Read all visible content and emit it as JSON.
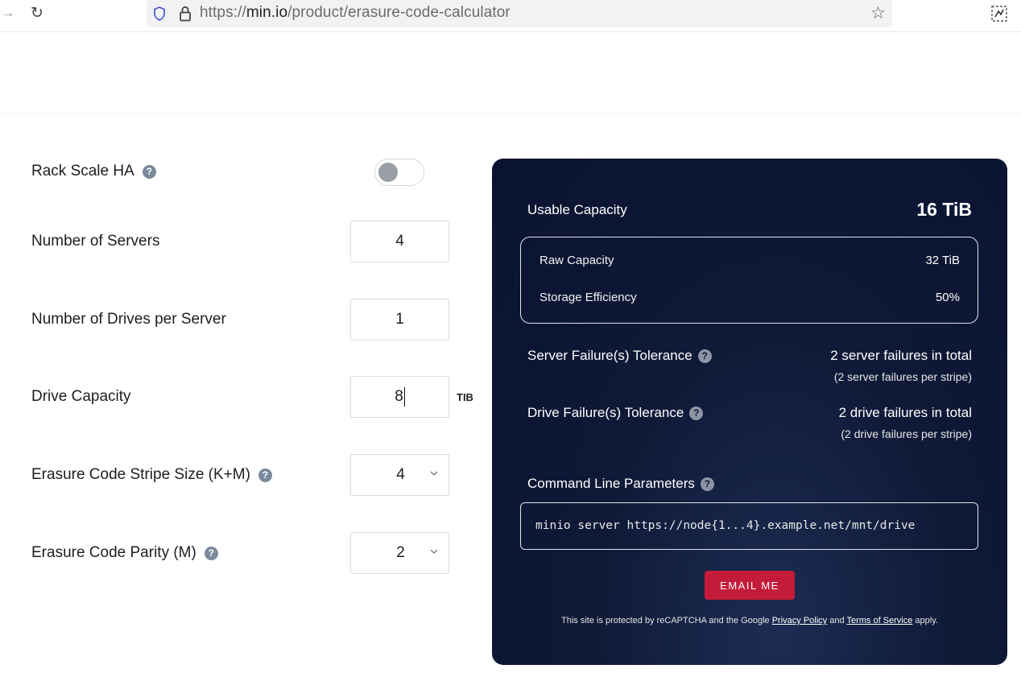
{
  "browser": {
    "url_prefix": "https://",
    "url_host": "min.io",
    "url_path": "/product/erasure-code-calculator"
  },
  "form": {
    "rack_scale_label": "Rack Scale HA",
    "rack_scale_enabled": false,
    "servers_label": "Number of Servers",
    "servers_value": "4",
    "drives_label": "Number of Drives per Server",
    "drives_value": "1",
    "capacity_label": "Drive Capacity",
    "capacity_value": "8",
    "capacity_unit": "TIB",
    "stripe_label": "Erasure Code Stripe Size (K+M)",
    "stripe_value": "4",
    "parity_label": "Erasure Code Parity (M)",
    "parity_value": "2",
    "help_glyph": "?"
  },
  "results": {
    "usable_label": "Usable Capacity",
    "usable_value": "16 TiB",
    "raw_label": "Raw Capacity",
    "raw_value": "32 TiB",
    "efficiency_label": "Storage Efficiency",
    "efficiency_value": "50%",
    "server_tol_label": "Server Failure(s) Tolerance",
    "server_tol_value": "2 server failures in total",
    "server_tol_sub": "(2 server failures per stripe)",
    "drive_tol_label": "Drive Failure(s) Tolerance",
    "drive_tol_value": "2 drive failures in total",
    "drive_tol_sub": "(2 drive failures per stripe)",
    "cmd_label": "Command Line Parameters",
    "cmd_value": "minio server https://node{1...4}.example.net/mnt/drive",
    "email_label": "EMAIL ME",
    "legal_prefix": "This site is protected by reCAPTCHA and the Google ",
    "privacy_link": "Privacy Policy",
    "legal_and": " and ",
    "terms_link": "Terms of Service",
    "legal_suffix": " apply."
  },
  "colors": {
    "panel_bg": "#0a1330",
    "email_button": "#c51b3a",
    "help_icon": "#7b8a9c"
  }
}
